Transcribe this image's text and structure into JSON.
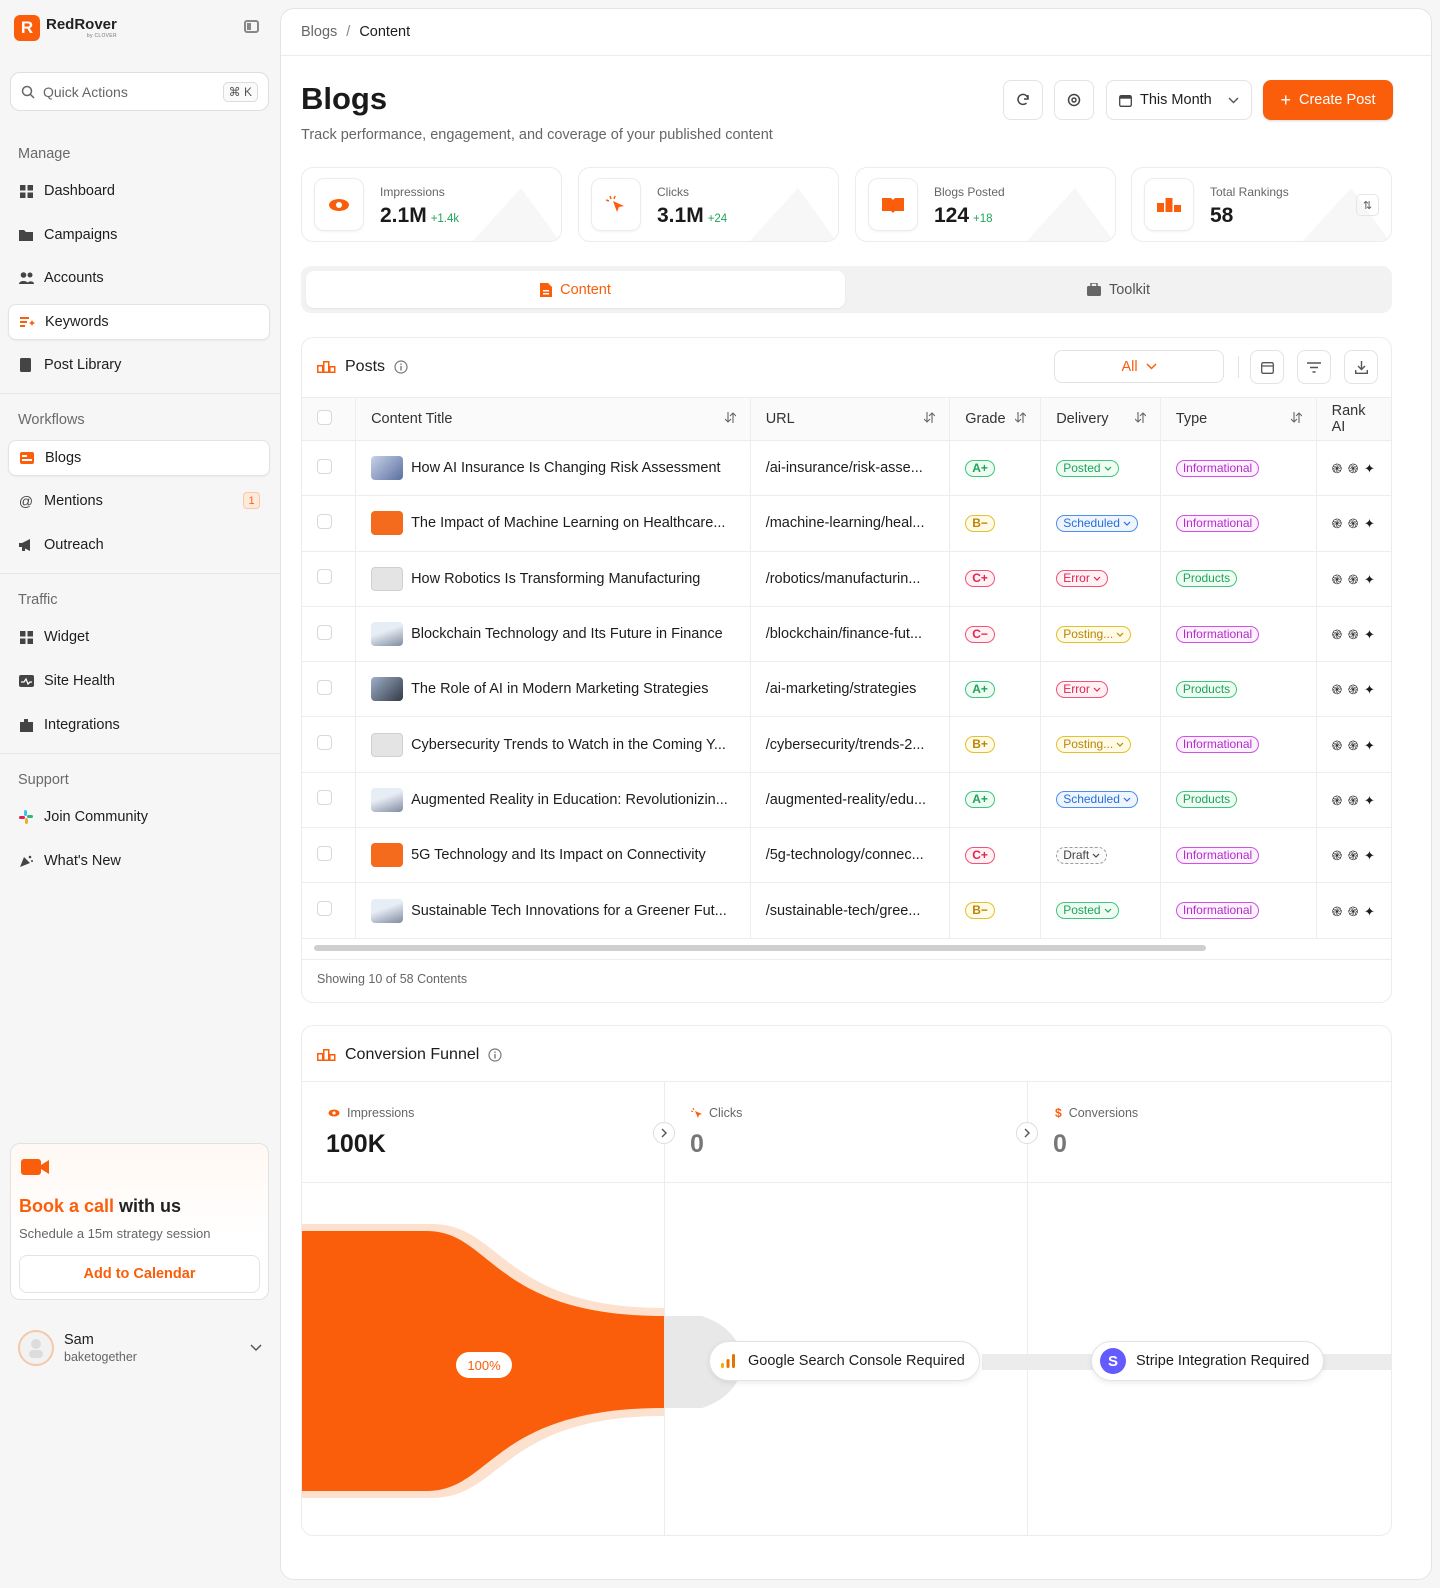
{
  "brand": {
    "name": "RedRover",
    "sub": "by CLOVER",
    "mark": "R"
  },
  "quick_actions": {
    "label": "Quick Actions",
    "shortcut": "⌘ K"
  },
  "sidebar": {
    "manage_title": "Manage",
    "manage": [
      {
        "label": "Dashboard",
        "icon": "grid-icon"
      },
      {
        "label": "Campaigns",
        "icon": "folder-icon"
      },
      {
        "label": "Accounts",
        "icon": "users-icon"
      },
      {
        "label": "Keywords",
        "icon": "keywords-icon"
      },
      {
        "label": "Post Library",
        "icon": "book-icon"
      }
    ],
    "workflows_title": "Workflows",
    "workflows": [
      {
        "label": "Blogs",
        "icon": "blog-icon"
      },
      {
        "label": "Mentions",
        "icon": "at-icon",
        "badge": "1"
      },
      {
        "label": "Outreach",
        "icon": "megaphone-icon"
      }
    ],
    "traffic_title": "Traffic",
    "traffic": [
      {
        "label": "Widget",
        "icon": "grid-icon"
      },
      {
        "label": "Site Health",
        "icon": "health-icon"
      },
      {
        "label": "Integrations",
        "icon": "puzzle-icon"
      }
    ],
    "support_title": "Support",
    "support": [
      {
        "label": "Join Community",
        "icon": "slack-icon"
      },
      {
        "label": "What's New",
        "icon": "party-icon"
      }
    ]
  },
  "book_call": {
    "title_accent": "Book a call",
    "title_rest": " with us",
    "subtitle": "Schedule a 15m strategy session",
    "button": "Add to Calendar"
  },
  "user": {
    "name": "Sam",
    "handle": "baketogether"
  },
  "breadcrumb": {
    "parent": "Blogs",
    "sep": "/",
    "current": "Content"
  },
  "header": {
    "title": "Blogs",
    "subtitle": "Track performance, engagement, and coverage of your published content",
    "range": "This Month",
    "create": "Create Post"
  },
  "stats": [
    {
      "label": "Impressions",
      "value": "2.1M",
      "delta": "+1.4k"
    },
    {
      "label": "Clicks",
      "value": "3.1M",
      "delta": "+24"
    },
    {
      "label": "Blogs Posted",
      "value": "124",
      "delta": "+18"
    },
    {
      "label": "Total Rankings",
      "value": "58",
      "delta": ""
    }
  ],
  "tabs": [
    {
      "label": "Content"
    },
    {
      "label": "Toolkit"
    }
  ],
  "posts": {
    "title": "Posts",
    "filter": "All",
    "columns": [
      "Content Title",
      "URL",
      "Grade",
      "Delivery",
      "Type",
      "Rank AI"
    ],
    "rows": [
      {
        "title": "How AI Insurance Is Changing Risk Assessment",
        "url": "/ai-insurance/risk-asse...",
        "grade": "A+",
        "delivery": "Posted",
        "type": "Informational",
        "thumb": "photo"
      },
      {
        "title": "The Impact of Machine Learning on Healthcare...",
        "url": "/machine-learning/heal...",
        "grade": "B−",
        "delivery": "Scheduled",
        "type": "Informational",
        "thumb": "orange"
      },
      {
        "title": "How Robotics Is Transforming Manufacturing",
        "url": "/robotics/manufacturin...",
        "grade": "C+",
        "delivery": "Error",
        "type": "Products",
        "thumb": "grey"
      },
      {
        "title": "Blockchain Technology and Its Future in Finance",
        "url": "/blockchain/finance-fut...",
        "grade": "C−",
        "delivery": "Posting...",
        "type": "Informational",
        "thumb": "drone"
      },
      {
        "title": "The Role of AI in Modern Marketing Strategies",
        "url": "/ai-marketing/strategies",
        "grade": "A+",
        "delivery": "Error",
        "type": "Products",
        "thumb": "shot"
      },
      {
        "title": "Cybersecurity Trends to Watch in the Coming Y...",
        "url": "/cybersecurity/trends-2...",
        "grade": "B+",
        "delivery": "Posting...",
        "type": "Informational",
        "thumb": "grey"
      },
      {
        "title": "Augmented Reality in Education: Revolutionizin...",
        "url": "/augmented-reality/edu...",
        "grade": "A+",
        "delivery": "Scheduled",
        "type": "Products",
        "thumb": "drone"
      },
      {
        "title": "5G Technology and Its Impact on Connectivity",
        "url": "/5g-technology/connec...",
        "grade": "C+",
        "delivery": "Draft",
        "type": "Informational",
        "thumb": "orange"
      },
      {
        "title": "Sustainable Tech Innovations for a Greener Fut...",
        "url": "/sustainable-tech/gree...",
        "grade": "B−",
        "delivery": "Posted",
        "type": "Informational",
        "thumb": "drone"
      }
    ],
    "rank_ai": "֎ ֍ ✦",
    "footer": "Showing 10 of 58 Contents"
  },
  "funnel": {
    "title": "Conversion Funnel",
    "stages": [
      {
        "label": "Impressions",
        "value": "100K"
      },
      {
        "label": "Clicks",
        "value": "0"
      },
      {
        "label": "Conversions",
        "value": "0"
      }
    ],
    "percent": "100%",
    "gsc": "Google Search Console Required",
    "stripe": "Stripe Integration Required",
    "stripe_mark": "S"
  },
  "colors": {
    "accent": "#fb5e0a",
    "success": "#1ea45a",
    "info": "#2870d8",
    "danger": "#e02452",
    "warning": "#b8860b",
    "purple": "#b12fc7"
  }
}
